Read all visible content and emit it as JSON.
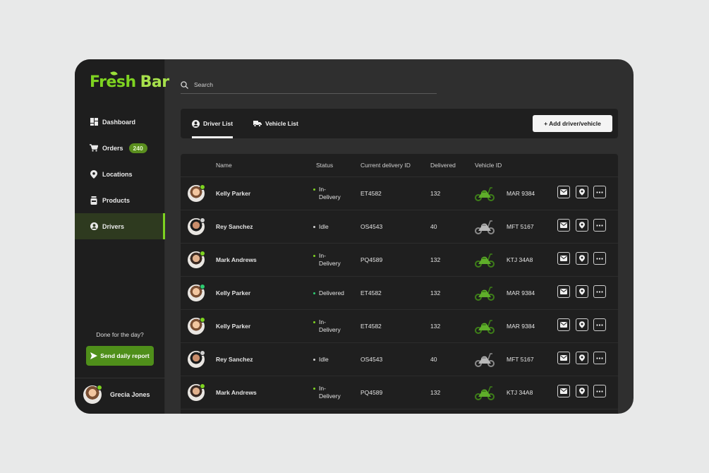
{
  "brand": {
    "word1": "Fresh",
    "word2": "Bar"
  },
  "colors": {
    "accent": "#7ed321",
    "active_bg": "#2e3a1f",
    "in_delivery": "#7ed321",
    "idle": "#d0d0d0",
    "delivered": "#2ecc71"
  },
  "sidebar": {
    "items": [
      {
        "label": "Dashboard",
        "icon": "dashboard-icon"
      },
      {
        "label": "Orders",
        "icon": "cart-icon",
        "badge": "240"
      },
      {
        "label": "Locations",
        "icon": "location-pin-icon"
      },
      {
        "label": "Products",
        "icon": "jar-icon"
      },
      {
        "label": "Drivers",
        "icon": "driver-icon",
        "active": true
      }
    ],
    "done_text": "Done for the day?",
    "report_button": "Send daily report",
    "user_name": "Grecia Jones"
  },
  "search": {
    "placeholder": "Search"
  },
  "tabs": [
    {
      "label": "Driver List",
      "icon": "person-circle-icon",
      "active": true
    },
    {
      "label": "Vehicle List",
      "icon": "truck-icon",
      "active": false
    }
  ],
  "add_button": "+ Add driver/vehicle",
  "table": {
    "headers": [
      "Name",
      "Status",
      "Current delivery ID",
      "Delivered",
      "Vehicle ID"
    ],
    "rows": [
      {
        "name": "Kelly Parker",
        "status": "In-Delivery",
        "delivery_id": "ET4582",
        "delivered": "132",
        "vehicle_id": "MAR 9384",
        "scooter": "green"
      },
      {
        "name": "Rey Sanchez",
        "status": "Idle",
        "delivery_id": "OS4543",
        "delivered": "40",
        "vehicle_id": "MFT 5167",
        "scooter": "gray"
      },
      {
        "name": "Mark Andrews",
        "status": "In-Delivery",
        "delivery_id": "PQ4589",
        "delivered": "132",
        "vehicle_id": "KTJ 34A8",
        "scooter": "green"
      },
      {
        "name": "Kelly Parker",
        "status": "Delivered",
        "delivery_id": "ET4582",
        "delivered": "132",
        "vehicle_id": "MAR 9384",
        "scooter": "green"
      },
      {
        "name": "Kelly Parker",
        "status": "In-Delivery",
        "delivery_id": "ET4582",
        "delivered": "132",
        "vehicle_id": "MAR 9384",
        "scooter": "green"
      },
      {
        "name": "Rey Sanchez",
        "status": "Idle",
        "delivery_id": "OS4543",
        "delivered": "40",
        "vehicle_id": "MFT 5167",
        "scooter": "gray"
      },
      {
        "name": "Mark Andrews",
        "status": "In-Delivery",
        "delivery_id": "PQ4589",
        "delivered": "132",
        "vehicle_id": "KTJ 34A8",
        "scooter": "green"
      }
    ]
  }
}
